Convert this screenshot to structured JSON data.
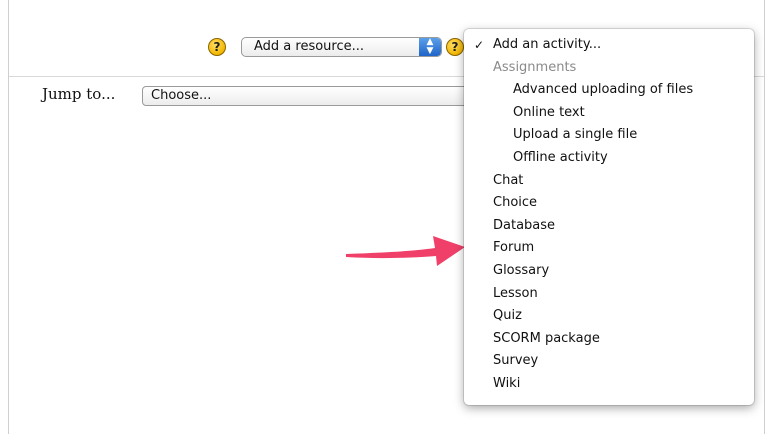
{
  "toolbar": {
    "help_glyph": "?",
    "resource_select_value": "Add a resource...",
    "activity_help_glyph": "?"
  },
  "jump": {
    "label": "Jump to...",
    "select_value": "Choose..."
  },
  "activity_menu": {
    "selected_mark": "✓",
    "items": [
      {
        "label": "Add an activity...",
        "type": "option",
        "selected": true
      },
      {
        "label": "Assignments",
        "type": "group"
      },
      {
        "label": "Advanced uploading of files",
        "type": "sub"
      },
      {
        "label": "Online text",
        "type": "sub"
      },
      {
        "label": "Upload a single file",
        "type": "sub"
      },
      {
        "label": "Offline activity",
        "type": "sub"
      },
      {
        "label": "Chat",
        "type": "option"
      },
      {
        "label": "Choice",
        "type": "option"
      },
      {
        "label": "Database",
        "type": "option"
      },
      {
        "label": "Forum",
        "type": "option"
      },
      {
        "label": "Glossary",
        "type": "option"
      },
      {
        "label": "Lesson",
        "type": "option"
      },
      {
        "label": "Quiz",
        "type": "option"
      },
      {
        "label": "SCORM package",
        "type": "option"
      },
      {
        "label": "Survey",
        "type": "option"
      },
      {
        "label": "Wiki",
        "type": "option"
      }
    ]
  },
  "colors": {
    "annotation_arrow": "#f0406a",
    "select_stepper": "#2f78d8",
    "help_icon": "#f2b600"
  }
}
